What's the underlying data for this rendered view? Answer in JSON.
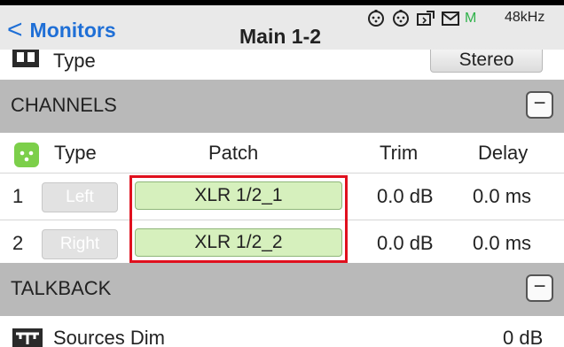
{
  "topbar": {
    "back_label": "Monitors",
    "title": "Main 1-2",
    "status_icons": [
      "xlr-connector-icon",
      "xlr-connector-icon",
      "device-icon",
      "mail-icon"
    ],
    "meter_label": "M",
    "sample_rate": "48kHz"
  },
  "type_row": {
    "label": "Type",
    "value": "Stereo"
  },
  "channels": {
    "section_title": "CHANNELS",
    "collapse_symbol": "−",
    "columns": {
      "type": "Type",
      "patch": "Patch",
      "trim": "Trim",
      "delay": "Delay"
    },
    "rows": [
      {
        "num": "1",
        "type": "Left",
        "patch": "XLR 1/2_1",
        "trim": "0.0 dB",
        "delay": "0.0 ms"
      },
      {
        "num": "2",
        "type": "Right",
        "patch": "XLR 1/2_2",
        "trim": "0.0 dB",
        "delay": "0.0 ms"
      }
    ]
  },
  "talkback": {
    "section_title": "TALKBACK",
    "collapse_symbol": "−",
    "sources_dim": {
      "label": "Sources Dim",
      "value": "0 dB"
    }
  },
  "colors": {
    "accent_blue": "#1f6fd6",
    "patch_green": "#d6f0bd",
    "xlr_icon_green": "#7ccf4a",
    "highlight_red": "#e0101e",
    "section_gray": "#b9b9b9"
  }
}
